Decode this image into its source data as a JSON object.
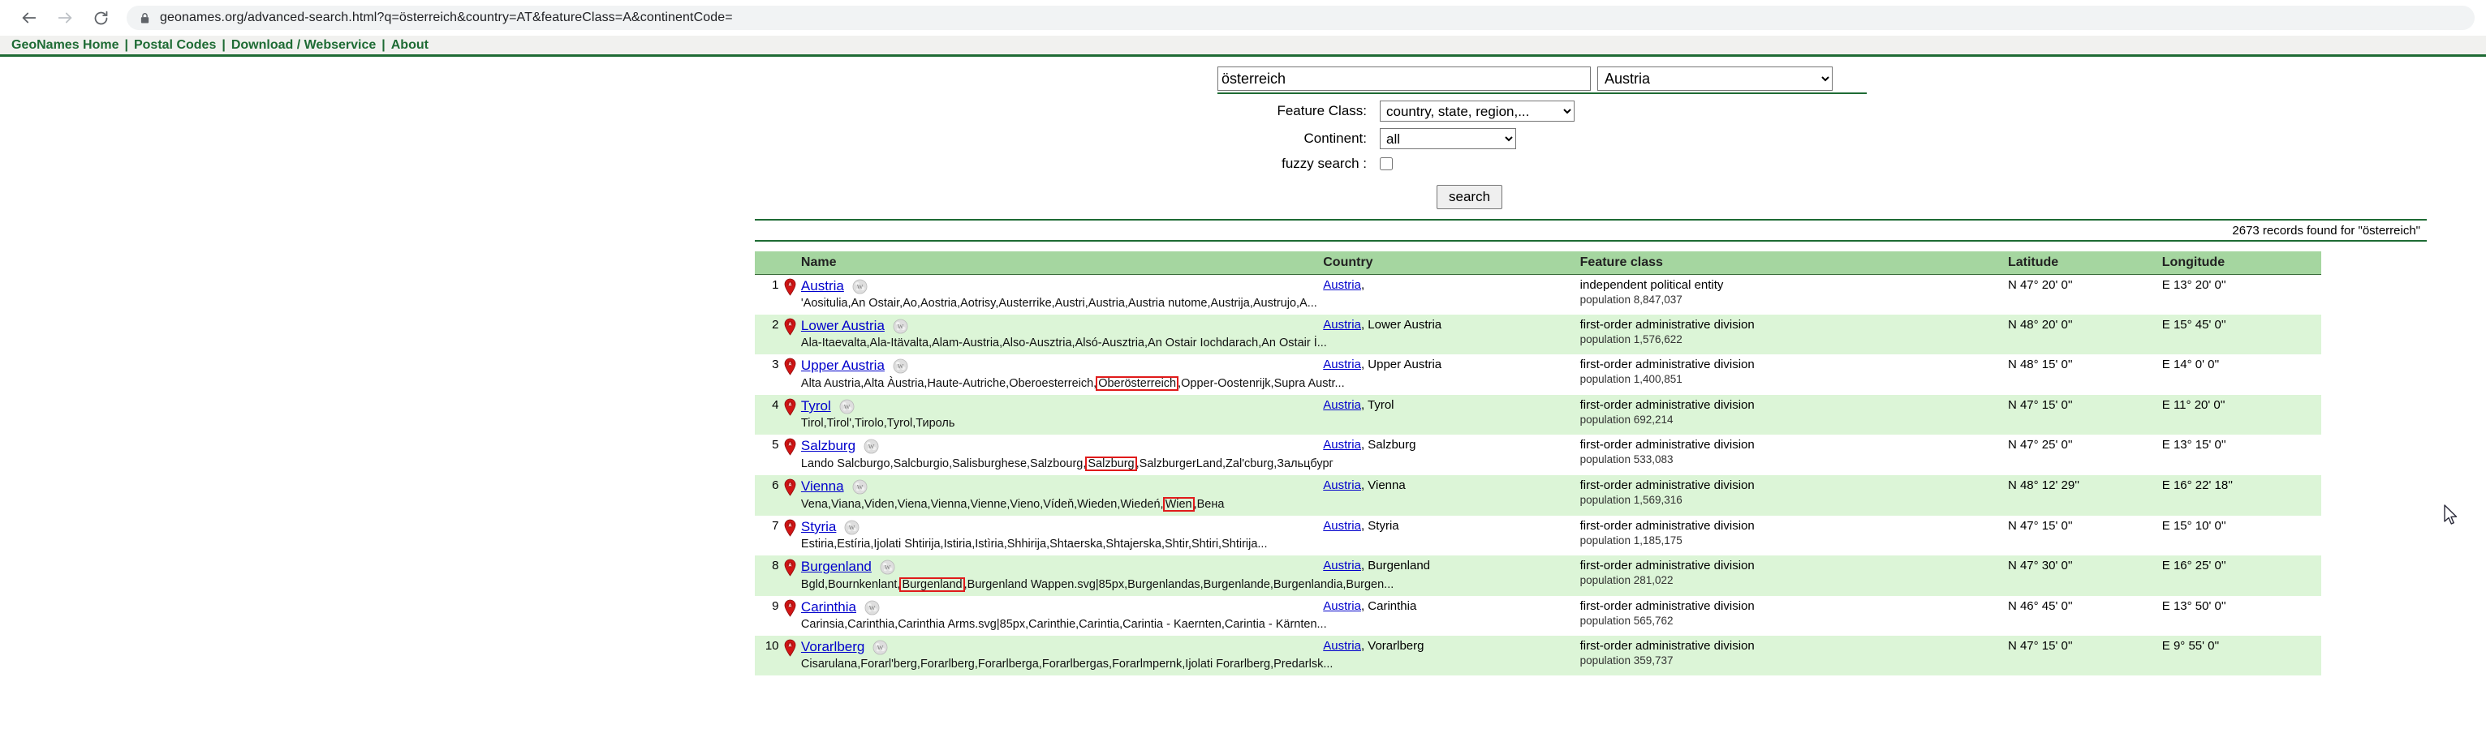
{
  "browser": {
    "back_icon": "back-arrow-icon",
    "forward_icon": "forward-arrow-icon",
    "reload_icon": "reload-icon",
    "lock_icon": "lock-icon",
    "url": "geonames.org/advanced-search.html?q=österreich&country=AT&featureClass=A&continentCode="
  },
  "site_nav": {
    "items": [
      {
        "label": "GeoNames Home"
      },
      {
        "label": "Postal Codes"
      },
      {
        "label": "Download / Webservice"
      },
      {
        "label": "About"
      }
    ],
    "separator": "|"
  },
  "search_form": {
    "query_value": "österreich",
    "query_placeholder": "",
    "country_selected": "Austria",
    "feature_class_label": "Feature Class:",
    "feature_class_selected": "country, state, region,...",
    "continent_label": "Continent:",
    "continent_selected": "all",
    "fuzzy_label": "fuzzy search :",
    "fuzzy_checked": false,
    "search_button": "search"
  },
  "results_meta": {
    "records_found": "2673 records found for \"österreich\""
  },
  "table": {
    "columns": [
      "Name",
      "Country",
      "Feature class",
      "Latitude",
      "Longitude"
    ],
    "rows": [
      {
        "num": "1",
        "pin": "map-pin-a-icon",
        "wiki": "wikipedia-icon",
        "name": "Austria",
        "alt_before": "'Aositulia,An Ostair,Ao,Aostria,Aotrisy,Austerrike,Austri,Austria,Austria nutome,Austrija,Austrujo,A...",
        "alt_highlight": "",
        "alt_after": "",
        "country_link": "Austria",
        "country_rest": ",",
        "feature_class": "independent political entity",
        "population": "population 8,847,037",
        "lat": "N 47° 20' 0''",
        "lon": "E 13° 20' 0''"
      },
      {
        "num": "2",
        "pin": "map-pin-a-icon",
        "wiki": "wikipedia-icon",
        "name": "Lower Austria",
        "alt_before": "Ala-Itaevalta,Ala-Itävalta,Alam-Austria,Also-Ausztria,Alsó-Ausztria,An Ostair Iochdarach,An Ostair İ...",
        "alt_highlight": "",
        "alt_after": "",
        "country_link": "Austria",
        "country_rest": ", Lower Austria",
        "feature_class": "first-order administrative division",
        "population": "population 1,576,622",
        "lat": "N 48° 20' 0''",
        "lon": "E 15° 45' 0''"
      },
      {
        "num": "3",
        "pin": "map-pin-a-icon",
        "wiki": "wikipedia-icon",
        "name": "Upper Austria",
        "alt_before": "Alta Austria,Alta Àustria,Haute-Autriche,Oberoesterreich,",
        "alt_highlight": "Oberösterreich",
        "alt_after": ",Opper-Oostenrijk,Supra Austr...",
        "country_link": "Austria",
        "country_rest": ", Upper Austria",
        "feature_class": "first-order administrative division",
        "population": "population 1,400,851",
        "lat": "N 48° 15' 0''",
        "lon": "E 14° 0' 0''"
      },
      {
        "num": "4",
        "pin": "map-pin-a-icon",
        "wiki": "wikipedia-icon",
        "name": "Tyrol",
        "alt_before": "Tirol,Tirol',Tirolo,Tyrol,Тироль",
        "alt_highlight": "",
        "alt_after": "",
        "country_link": "Austria",
        "country_rest": ", Tyrol",
        "feature_class": "first-order administrative division",
        "population": "population 692,214",
        "lat": "N 47° 15' 0''",
        "lon": "E 11° 20' 0''"
      },
      {
        "num": "5",
        "pin": "map-pin-a-icon",
        "wiki": "wikipedia-icon",
        "name": "Salzburg",
        "alt_before": "Lando Salcburgo,Salcburgio,Salisburghese,Salzbourg,",
        "alt_highlight": "Salzburg",
        "alt_after": ",SalzburgerLand,Zal'cburg,Зальцбург",
        "country_link": "Austria",
        "country_rest": ", Salzburg",
        "feature_class": "first-order administrative division",
        "population": "population 533,083",
        "lat": "N 47° 25' 0''",
        "lon": "E 13° 15' 0''"
      },
      {
        "num": "6",
        "pin": "map-pin-a-icon",
        "wiki": "wikipedia-icon",
        "name": "Vienna",
        "alt_before": "Vena,Viana,Viden,Viena,Vienna,Vienne,Vieno,Vídeň,Wieden,Wiedeń,",
        "alt_highlight": "Wien",
        "alt_after": ",Вена",
        "country_link": "Austria",
        "country_rest": ", Vienna",
        "feature_class": "first-order administrative division",
        "population": "population 1,569,316",
        "lat": "N 48° 12' 29''",
        "lon": "E 16° 22' 18''"
      },
      {
        "num": "7",
        "pin": "map-pin-a-icon",
        "wiki": "wikipedia-icon",
        "name": "Styria",
        "alt_before": "Estiria,Estíria,Ijolati Shtirija,Istiria,Istìria,Shhirija,Shtaerska,Shtajerska,Shtir,Shtiri,Shtirija...",
        "alt_highlight": "",
        "alt_after": "",
        "country_link": "Austria",
        "country_rest": ", Styria",
        "feature_class": "first-order administrative division",
        "population": "population 1,185,175",
        "lat": "N 47° 15' 0''",
        "lon": "E 15° 10' 0''"
      },
      {
        "num": "8",
        "pin": "map-pin-a-icon",
        "wiki": "wikipedia-icon",
        "name": "Burgenland",
        "alt_before": "Bgld,Bournkenlant,",
        "alt_highlight": "Burgenland",
        "alt_after": ",Burgenland Wappen.svg|85px,Burgenlandas,Burgenlande,Burgenlandia,Burgen...",
        "country_link": "Austria",
        "country_rest": ", Burgenland",
        "feature_class": "first-order administrative division",
        "population": "population 281,022",
        "lat": "N 47° 30' 0''",
        "lon": "E 16° 25' 0''"
      },
      {
        "num": "9",
        "pin": "map-pin-a-icon",
        "wiki": "wikipedia-icon",
        "name": "Carinthia",
        "alt_before": "Carinsia,Carinthia,Carinthia Arms.svg|85px,Carinthie,Carintia,Carintia - Kaernten,Carintia - Kärnten...",
        "alt_highlight": "",
        "alt_after": "",
        "country_link": "Austria",
        "country_rest": ", Carinthia",
        "feature_class": "first-order administrative division",
        "population": "population 565,762",
        "lat": "N 46° 45' 0''",
        "lon": "E 13° 50' 0''"
      },
      {
        "num": "10",
        "pin": "map-pin-a-icon",
        "wiki": "wikipedia-icon",
        "name": "Vorarlberg",
        "alt_before": "Cisarulana,Forarl'berg,Forarlberg,Forarlberga,Forarlbergas,Forarlmpernk,Ijolati Forarlberg,Predarlsk...",
        "alt_highlight": "",
        "alt_after": "",
        "country_link": "Austria",
        "country_rest": ", Vorarlberg",
        "feature_class": "first-order administrative division",
        "population": "population 359,737",
        "lat": "N 47° 15' 0''",
        "lon": "E 9° 55' 0''"
      }
    ]
  },
  "colors": {
    "brand_green": "#1e6b34",
    "header_green": "#a5d6a0",
    "row_alt_green": "#dcf5d7",
    "link_blue": "#0000cc",
    "highlight_red": "#e01b1b"
  }
}
